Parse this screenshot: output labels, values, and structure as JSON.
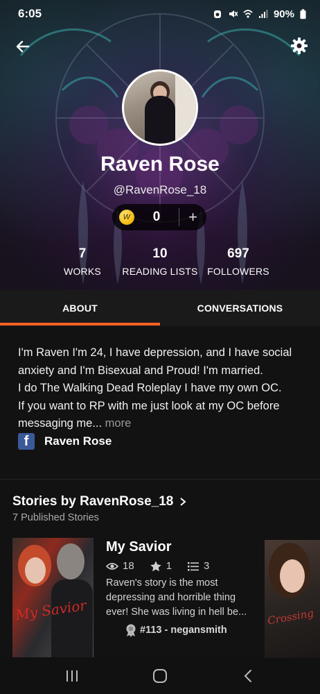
{
  "status_bar": {
    "time": "6:05",
    "battery": "90%",
    "icons": [
      "alarm-icon",
      "mute-icon",
      "wifi-icon",
      "signal-icon",
      "battery-icon"
    ]
  },
  "header": {
    "back_icon": "back-arrow-icon",
    "settings_icon": "gear-icon"
  },
  "profile": {
    "display_name": "Raven Rose",
    "username": "@RavenRose_18",
    "coins": "0",
    "coin_add": "+"
  },
  "stats": [
    {
      "value": "7",
      "label": "WORKS"
    },
    {
      "value": "10",
      "label": "READING LISTS"
    },
    {
      "value": "697",
      "label": "FOLLOWERS"
    }
  ],
  "tabs": {
    "about": "ABOUT",
    "conversations": "CONVERSATIONS",
    "active": "about"
  },
  "about": {
    "line1": "I'm Raven I'm 24, I have depression, and I have social anxiety and I'm Bisexual and Proud! I'm married.",
    "line2": "I do The Walking Dead Roleplay I have my own OC.",
    "line3": "If you want to RP with me just look at my OC before messaging me",
    "ellipsis": "...",
    "more": "more",
    "facebook_name": "Raven Rose"
  },
  "stories": {
    "title": "Stories by RavenRose_18",
    "subtitle": "7 Published Stories",
    "items": [
      {
        "title": "My Savior",
        "cover_text": "My Savior",
        "reads": "18",
        "votes": "1",
        "parts": "3",
        "description": "Raven's story is the most depressing and horrible thing ever! She was living in hell be...",
        "rank": "#113 - negansmith"
      },
      {
        "cover_text": "Crossing"
      }
    ]
  },
  "colors": {
    "accent": "#ff6122",
    "background": "#121212",
    "tab_bar": "#1a1a1a",
    "facebook": "#3b5998",
    "coin": "#f2b705"
  }
}
